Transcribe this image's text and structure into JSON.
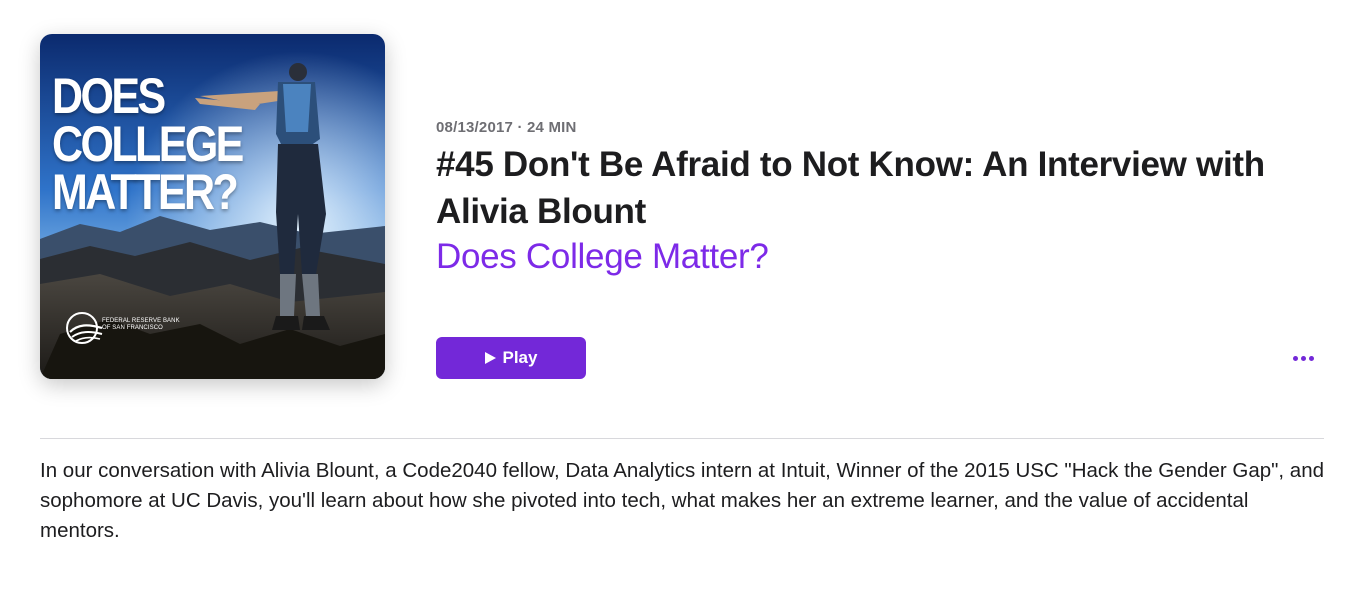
{
  "artwork": {
    "title_lines": [
      "DOES",
      "COLLEGE",
      "MATTER?"
    ],
    "org_line_1": "FEDERAL RESERVE BANK",
    "org_line_2": "OF SAN FRANCISCO"
  },
  "episode": {
    "meta": "08/13/2017 · 24 MIN",
    "title": "#45 Don't Be Afraid to Not Know: An Interview with Alivia Blount",
    "show_name": "Does College Matter?",
    "play_label": "Play",
    "description": "In our conversation with Alivia Blount, a Code2040 fellow, Data Analytics intern at Intuit, Winner of the 2015 USC \"Hack the Gender Gap\", and sophomore at UC Davis, you'll learn about how she pivoted into tech, what makes her an extreme learner, and the value of accidental mentors."
  },
  "icons": {
    "play": "play-icon",
    "more": "more-icon",
    "logo": "federal-reserve-logo"
  },
  "colors": {
    "accent": "#7328d8",
    "link": "#7d2ae8",
    "meta_text": "#6e6e73",
    "body_text": "#1d1d1f"
  }
}
